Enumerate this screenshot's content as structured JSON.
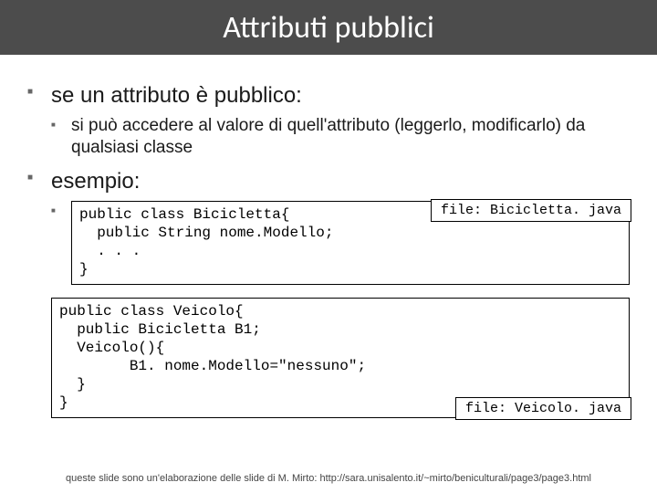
{
  "title": "Attributi pubblici",
  "bullets": {
    "b1": "se un attributo è pubblico:",
    "b1_sub1": "si può accedere al valore di quell'attributo (leggerlo, modificarlo) da qualsiasi classe",
    "b2": "esempio:"
  },
  "code1": {
    "text": "public class Bicicletta{\n  public String nome.Modello;\n  . . .\n}",
    "file_label": "file: Bicicletta. java"
  },
  "code2": {
    "text": "public class Veicolo{\n  public Bicicletta B1;\n  Veicolo(){\n        B1. nome.Modello=\"nessuno\";\n  }\n}",
    "file_label": "file: Veicolo. java"
  },
  "footer": "queste slide sono un'elaborazione delle slide di M. Mirto: http://sara.unisalento.it/~mirto/beniculturali/page3/page3.html"
}
